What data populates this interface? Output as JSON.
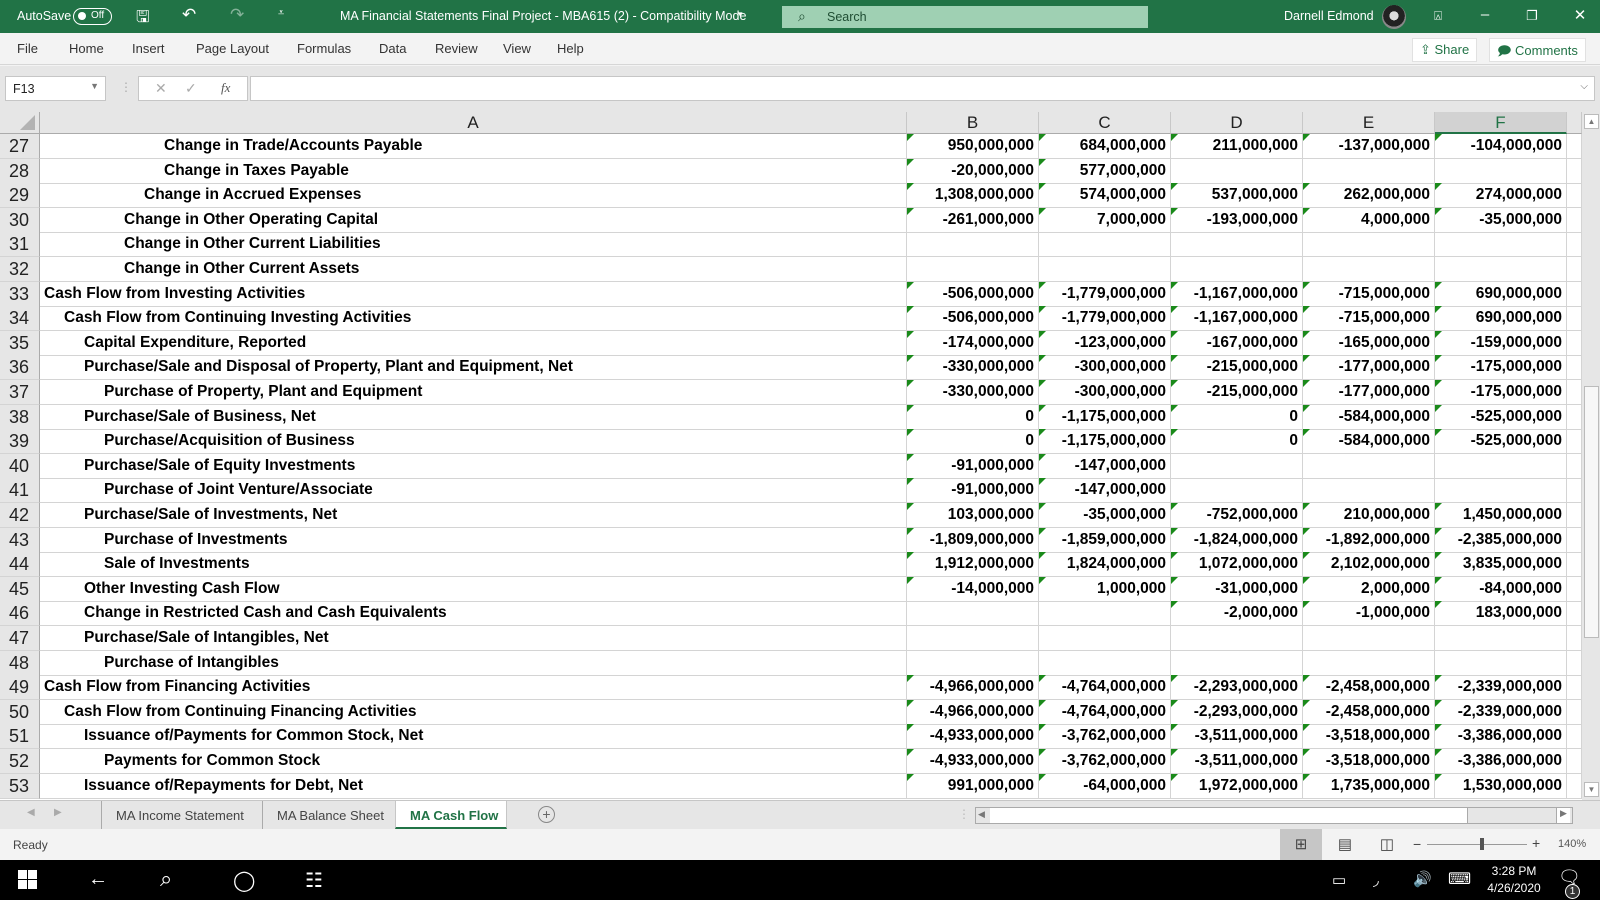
{
  "titlebar": {
    "autosave_label": "AutoSave",
    "autosave_state": "Off",
    "document_title": "MA Financial Statements Final Project - MBA615 (2)  -  Compatibility Mode",
    "search_placeholder": "Search",
    "user_name": "Darnell Edmond"
  },
  "ribbon": {
    "tabs": [
      "File",
      "Home",
      "Insert",
      "Page Layout",
      "Formulas",
      "Data",
      "Review",
      "View",
      "Help"
    ],
    "share_label": "Share",
    "comments_label": "Comments"
  },
  "formula_bar": {
    "name_box": "F13",
    "formula": "",
    "fx_label": "fx"
  },
  "columns": [
    "A",
    "B",
    "C",
    "D",
    "E",
    "F"
  ],
  "selected_column": "F",
  "rows": [
    {
      "n": "27",
      "indent": 6,
      "label": "Change in Trade/Accounts Payable",
      "values": [
        "950,000,000",
        "684,000,000",
        "211,000,000",
        "-137,000,000",
        "-104,000,000"
      ]
    },
    {
      "n": "28",
      "indent": 6,
      "label": "Change in Taxes Payable",
      "values": [
        "-20,000,000",
        "577,000,000",
        "",
        "",
        ""
      ]
    },
    {
      "n": "29",
      "indent": 5,
      "label": "Change in Accrued Expenses",
      "values": [
        "1,308,000,000",
        "574,000,000",
        "537,000,000",
        "262,000,000",
        "274,000,000"
      ]
    },
    {
      "n": "30",
      "indent": 4,
      "label": "Change in Other Operating Capital",
      "values": [
        "-261,000,000",
        "7,000,000",
        "-193,000,000",
        "4,000,000",
        "-35,000,000"
      ]
    },
    {
      "n": "31",
      "indent": 4,
      "label": "Change in Other Current Liabilities",
      "values": [
        "",
        "",
        "",
        "",
        ""
      ]
    },
    {
      "n": "32",
      "indent": 4,
      "label": "Change in Other Current Assets",
      "values": [
        "",
        "",
        "",
        "",
        ""
      ]
    },
    {
      "n": "33",
      "indent": 0,
      "label": "Cash Flow from Investing Activities",
      "values": [
        "-506,000,000",
        "-1,779,000,000",
        "-1,167,000,000",
        "-715,000,000",
        "690,000,000"
      ]
    },
    {
      "n": "34",
      "indent": 1,
      "label": "Cash Flow from Continuing Investing Activities",
      "values": [
        "-506,000,000",
        "-1,779,000,000",
        "-1,167,000,000",
        "-715,000,000",
        "690,000,000"
      ]
    },
    {
      "n": "35",
      "indent": 2,
      "label": "Capital Expenditure, Reported",
      "values": [
        "-174,000,000",
        "-123,000,000",
        "-167,000,000",
        "-165,000,000",
        "-159,000,000"
      ]
    },
    {
      "n": "36",
      "indent": 2,
      "label": "Purchase/Sale and Disposal of Property, Plant and Equipment, Net",
      "values": [
        "-330,000,000",
        "-300,000,000",
        "-215,000,000",
        "-177,000,000",
        "-175,000,000"
      ]
    },
    {
      "n": "37",
      "indent": 3,
      "label": "Purchase of Property, Plant and Equipment",
      "values": [
        "-330,000,000",
        "-300,000,000",
        "-215,000,000",
        "-177,000,000",
        "-175,000,000"
      ]
    },
    {
      "n": "38",
      "indent": 2,
      "label": "Purchase/Sale of Business, Net",
      "values": [
        "0",
        "-1,175,000,000",
        "0",
        "-584,000,000",
        "-525,000,000"
      ]
    },
    {
      "n": "39",
      "indent": 3,
      "label": "Purchase/Acquisition of Business",
      "values": [
        "0",
        "-1,175,000,000",
        "0",
        "-584,000,000",
        "-525,000,000"
      ]
    },
    {
      "n": "40",
      "indent": 2,
      "label": "Purchase/Sale of Equity Investments",
      "values": [
        "-91,000,000",
        "-147,000,000",
        "",
        "",
        ""
      ]
    },
    {
      "n": "41",
      "indent": 3,
      "label": "Purchase of Joint Venture/Associate",
      "values": [
        "-91,000,000",
        "-147,000,000",
        "",
        "",
        ""
      ]
    },
    {
      "n": "42",
      "indent": 2,
      "label": "Purchase/Sale of Investments, Net",
      "values": [
        "103,000,000",
        "-35,000,000",
        "-752,000,000",
        "210,000,000",
        "1,450,000,000"
      ]
    },
    {
      "n": "43",
      "indent": 3,
      "label": "Purchase of Investments",
      "values": [
        "-1,809,000,000",
        "-1,859,000,000",
        "-1,824,000,000",
        "-1,892,000,000",
        "-2,385,000,000"
      ]
    },
    {
      "n": "44",
      "indent": 3,
      "label": "Sale of Investments",
      "values": [
        "1,912,000,000",
        "1,824,000,000",
        "1,072,000,000",
        "2,102,000,000",
        "3,835,000,000"
      ]
    },
    {
      "n": "45",
      "indent": 2,
      "label": "Other Investing Cash Flow",
      "values": [
        "-14,000,000",
        "1,000,000",
        "-31,000,000",
        "2,000,000",
        "-84,000,000"
      ]
    },
    {
      "n": "46",
      "indent": 2,
      "label": "Change in Restricted Cash and Cash Equivalents",
      "values": [
        "",
        "",
        "-2,000,000",
        "-1,000,000",
        "183,000,000"
      ]
    },
    {
      "n": "47",
      "indent": 2,
      "label": "Purchase/Sale of Intangibles, Net",
      "values": [
        "",
        "",
        "",
        "",
        ""
      ]
    },
    {
      "n": "48",
      "indent": 3,
      "label": "Purchase of Intangibles",
      "values": [
        "",
        "",
        "",
        "",
        ""
      ]
    },
    {
      "n": "49",
      "indent": 0,
      "label": "Cash Flow from Financing Activities",
      "values": [
        "-4,966,000,000",
        "-4,764,000,000",
        "-2,293,000,000",
        "-2,458,000,000",
        "-2,339,000,000"
      ]
    },
    {
      "n": "50",
      "indent": 1,
      "label": "Cash Flow from Continuing Financing Activities",
      "values": [
        "-4,966,000,000",
        "-4,764,000,000",
        "-2,293,000,000",
        "-2,458,000,000",
        "-2,339,000,000"
      ]
    },
    {
      "n": "51",
      "indent": 2,
      "label": "Issuance of/Payments for Common Stock, Net",
      "values": [
        "-4,933,000,000",
        "-3,762,000,000",
        "-3,511,000,000",
        "-3,518,000,000",
        "-3,386,000,000"
      ]
    },
    {
      "n": "52",
      "indent": 3,
      "label": "Payments for Common Stock",
      "values": [
        "-4,933,000,000",
        "-3,762,000,000",
        "-3,511,000,000",
        "-3,518,000,000",
        "-3,386,000,000"
      ]
    },
    {
      "n": "53",
      "indent": 2,
      "label": "Issuance of/Repayments for Debt, Net",
      "values": [
        "991,000,000",
        "-64,000,000",
        "1,972,000,000",
        "1,735,000,000",
        "1,530,000,000"
      ]
    }
  ],
  "sheet_tabs": [
    {
      "label": "MA Income Statement",
      "active": false
    },
    {
      "label": "MA Balance Sheet",
      "active": false
    },
    {
      "label": "MA Cash Flow",
      "active": true
    }
  ],
  "status": {
    "ready": "Ready",
    "zoom_level": "140%",
    "zoom_percent": 140
  },
  "taskbar": {
    "time": "3:28 PM",
    "date": "4/26/2020",
    "notification_count": "1"
  },
  "colors": {
    "excel_green": "#217346",
    "error_triangle": "#1a8a1a"
  }
}
